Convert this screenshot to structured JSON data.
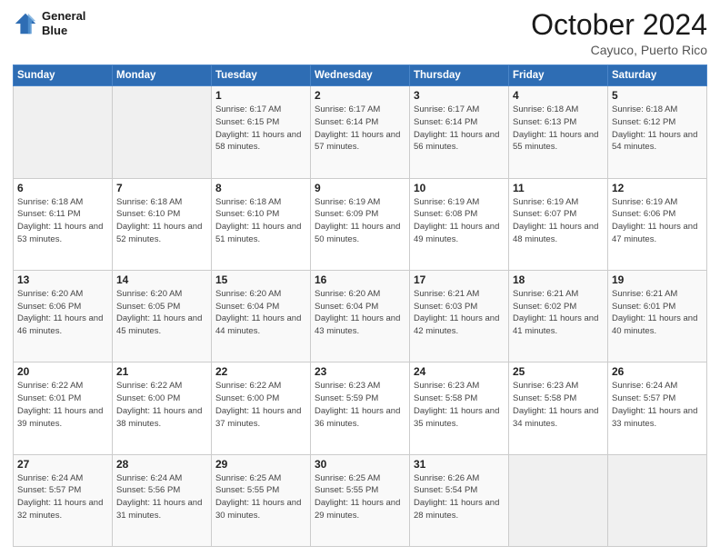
{
  "header": {
    "logo_line1": "General",
    "logo_line2": "Blue",
    "month": "October 2024",
    "location": "Cayuco, Puerto Rico"
  },
  "weekdays": [
    "Sunday",
    "Monday",
    "Tuesday",
    "Wednesday",
    "Thursday",
    "Friday",
    "Saturday"
  ],
  "weeks": [
    [
      {
        "day": "",
        "empty": true
      },
      {
        "day": "",
        "empty": true
      },
      {
        "day": "1",
        "sunrise": "Sunrise: 6:17 AM",
        "sunset": "Sunset: 6:15 PM",
        "daylight": "Daylight: 11 hours and 58 minutes."
      },
      {
        "day": "2",
        "sunrise": "Sunrise: 6:17 AM",
        "sunset": "Sunset: 6:14 PM",
        "daylight": "Daylight: 11 hours and 57 minutes."
      },
      {
        "day": "3",
        "sunrise": "Sunrise: 6:17 AM",
        "sunset": "Sunset: 6:14 PM",
        "daylight": "Daylight: 11 hours and 56 minutes."
      },
      {
        "day": "4",
        "sunrise": "Sunrise: 6:18 AM",
        "sunset": "Sunset: 6:13 PM",
        "daylight": "Daylight: 11 hours and 55 minutes."
      },
      {
        "day": "5",
        "sunrise": "Sunrise: 6:18 AM",
        "sunset": "Sunset: 6:12 PM",
        "daylight": "Daylight: 11 hours and 54 minutes."
      }
    ],
    [
      {
        "day": "6",
        "sunrise": "Sunrise: 6:18 AM",
        "sunset": "Sunset: 6:11 PM",
        "daylight": "Daylight: 11 hours and 53 minutes."
      },
      {
        "day": "7",
        "sunrise": "Sunrise: 6:18 AM",
        "sunset": "Sunset: 6:10 PM",
        "daylight": "Daylight: 11 hours and 52 minutes."
      },
      {
        "day": "8",
        "sunrise": "Sunrise: 6:18 AM",
        "sunset": "Sunset: 6:10 PM",
        "daylight": "Daylight: 11 hours and 51 minutes."
      },
      {
        "day": "9",
        "sunrise": "Sunrise: 6:19 AM",
        "sunset": "Sunset: 6:09 PM",
        "daylight": "Daylight: 11 hours and 50 minutes."
      },
      {
        "day": "10",
        "sunrise": "Sunrise: 6:19 AM",
        "sunset": "Sunset: 6:08 PM",
        "daylight": "Daylight: 11 hours and 49 minutes."
      },
      {
        "day": "11",
        "sunrise": "Sunrise: 6:19 AM",
        "sunset": "Sunset: 6:07 PM",
        "daylight": "Daylight: 11 hours and 48 minutes."
      },
      {
        "day": "12",
        "sunrise": "Sunrise: 6:19 AM",
        "sunset": "Sunset: 6:06 PM",
        "daylight": "Daylight: 11 hours and 47 minutes."
      }
    ],
    [
      {
        "day": "13",
        "sunrise": "Sunrise: 6:20 AM",
        "sunset": "Sunset: 6:06 PM",
        "daylight": "Daylight: 11 hours and 46 minutes."
      },
      {
        "day": "14",
        "sunrise": "Sunrise: 6:20 AM",
        "sunset": "Sunset: 6:05 PM",
        "daylight": "Daylight: 11 hours and 45 minutes."
      },
      {
        "day": "15",
        "sunrise": "Sunrise: 6:20 AM",
        "sunset": "Sunset: 6:04 PM",
        "daylight": "Daylight: 11 hours and 44 minutes."
      },
      {
        "day": "16",
        "sunrise": "Sunrise: 6:20 AM",
        "sunset": "Sunset: 6:04 PM",
        "daylight": "Daylight: 11 hours and 43 minutes."
      },
      {
        "day": "17",
        "sunrise": "Sunrise: 6:21 AM",
        "sunset": "Sunset: 6:03 PM",
        "daylight": "Daylight: 11 hours and 42 minutes."
      },
      {
        "day": "18",
        "sunrise": "Sunrise: 6:21 AM",
        "sunset": "Sunset: 6:02 PM",
        "daylight": "Daylight: 11 hours and 41 minutes."
      },
      {
        "day": "19",
        "sunrise": "Sunrise: 6:21 AM",
        "sunset": "Sunset: 6:01 PM",
        "daylight": "Daylight: 11 hours and 40 minutes."
      }
    ],
    [
      {
        "day": "20",
        "sunrise": "Sunrise: 6:22 AM",
        "sunset": "Sunset: 6:01 PM",
        "daylight": "Daylight: 11 hours and 39 minutes."
      },
      {
        "day": "21",
        "sunrise": "Sunrise: 6:22 AM",
        "sunset": "Sunset: 6:00 PM",
        "daylight": "Daylight: 11 hours and 38 minutes."
      },
      {
        "day": "22",
        "sunrise": "Sunrise: 6:22 AM",
        "sunset": "Sunset: 6:00 PM",
        "daylight": "Daylight: 11 hours and 37 minutes."
      },
      {
        "day": "23",
        "sunrise": "Sunrise: 6:23 AM",
        "sunset": "Sunset: 5:59 PM",
        "daylight": "Daylight: 11 hours and 36 minutes."
      },
      {
        "day": "24",
        "sunrise": "Sunrise: 6:23 AM",
        "sunset": "Sunset: 5:58 PM",
        "daylight": "Daylight: 11 hours and 35 minutes."
      },
      {
        "day": "25",
        "sunrise": "Sunrise: 6:23 AM",
        "sunset": "Sunset: 5:58 PM",
        "daylight": "Daylight: 11 hours and 34 minutes."
      },
      {
        "day": "26",
        "sunrise": "Sunrise: 6:24 AM",
        "sunset": "Sunset: 5:57 PM",
        "daylight": "Daylight: 11 hours and 33 minutes."
      }
    ],
    [
      {
        "day": "27",
        "sunrise": "Sunrise: 6:24 AM",
        "sunset": "Sunset: 5:57 PM",
        "daylight": "Daylight: 11 hours and 32 minutes."
      },
      {
        "day": "28",
        "sunrise": "Sunrise: 6:24 AM",
        "sunset": "Sunset: 5:56 PM",
        "daylight": "Daylight: 11 hours and 31 minutes."
      },
      {
        "day": "29",
        "sunrise": "Sunrise: 6:25 AM",
        "sunset": "Sunset: 5:55 PM",
        "daylight": "Daylight: 11 hours and 30 minutes."
      },
      {
        "day": "30",
        "sunrise": "Sunrise: 6:25 AM",
        "sunset": "Sunset: 5:55 PM",
        "daylight": "Daylight: 11 hours and 29 minutes."
      },
      {
        "day": "31",
        "sunrise": "Sunrise: 6:26 AM",
        "sunset": "Sunset: 5:54 PM",
        "daylight": "Daylight: 11 hours and 28 minutes."
      },
      {
        "day": "",
        "empty": true
      },
      {
        "day": "",
        "empty": true
      }
    ]
  ]
}
